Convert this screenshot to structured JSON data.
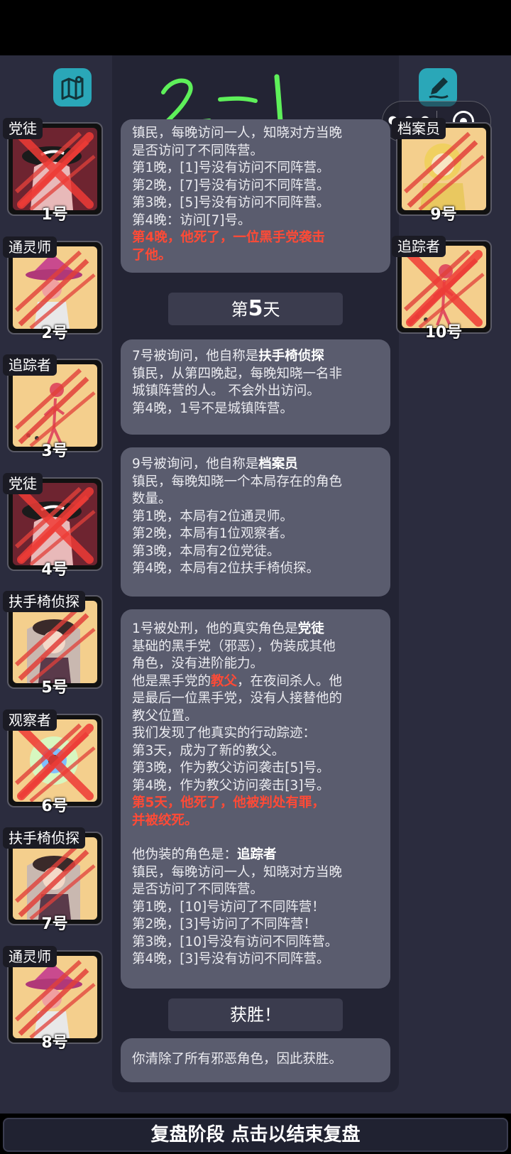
{
  "toolbar": {
    "map_icon": "map-icon",
    "edit_icon": "pen-icon",
    "capsule_more": "•••",
    "capsule_close_icon": "target-close-icon"
  },
  "left_players": [
    {
      "role": "党徒",
      "num": "1号",
      "art": "gangster",
      "crossed": true
    },
    {
      "role": "通灵师",
      "num": "2号",
      "art": "medium",
      "crossed": false
    },
    {
      "role": "追踪者",
      "num": "3号",
      "art": "tracker",
      "crossed": false
    },
    {
      "role": "党徒",
      "num": "4号",
      "art": "gangster",
      "crossed": true
    },
    {
      "role": "扶手椅侦探",
      "num": "5号",
      "art": "detective",
      "crossed": false
    },
    {
      "role": "观察者",
      "num": "6号",
      "art": "observer",
      "crossed": true
    },
    {
      "role": "扶手椅侦探",
      "num": "7号",
      "art": "detective",
      "crossed": false
    },
    {
      "role": "通灵师",
      "num": "8号",
      "art": "medium",
      "crossed": false
    }
  ],
  "right_players": [
    {
      "role": "档案员",
      "num": "9号",
      "art": "archivist",
      "crossed": false
    },
    {
      "role": "追踪者",
      "num": "10号",
      "art": "tracker",
      "crossed": true
    }
  ],
  "card1": {
    "lines": [
      "镇民，每晚访问一人，知晓对方当晚",
      "是否访问了不同阵营。",
      "第1晚，[1]号没有访问不同阵营。",
      "第2晚，[7]号没有访问不同阵营。",
      "第3晚，[5]号没有访问不同阵营。",
      "第4晚：访问[7]号。"
    ],
    "red": [
      "第4晚，他死了，一位黑手党袭击",
      "了他。"
    ]
  },
  "day5": {
    "prefix": "第",
    "num": "5",
    "suffix": "天"
  },
  "card2": {
    "intro": "7号被询问，他自称是",
    "role": "扶手椅侦探",
    "lines": [
      "镇民，从第四晚起，每晚知晓一名非",
      "城镇阵营的人。 不会外出访问。",
      "第4晚，1号不是城镇阵营。"
    ]
  },
  "card3": {
    "intro": "9号被询问，他自称是",
    "role": "档案员",
    "lines": [
      "镇民，每晚知晓一个本局存在的角色",
      "数量。",
      "第1晚，本局有2位通灵师。",
      "第2晚，本局有1位观察者。",
      "第3晚，本局有2位党徒。",
      "第4晚，本局有2位扶手椅侦探。"
    ]
  },
  "card4": {
    "intro": "1号被处刑，他的真实角色是",
    "role": "党徒",
    "line_a": "基础的黑手党（邪恶），伪装成其他",
    "line_b": "角色，没有进阶能力。",
    "line_c_pre": "他是黑手党的",
    "line_c_red": "教父",
    "line_c_post": "，在夜间杀人。他",
    "line_d": "是最后一位黑手党，没有人接替他的",
    "line_e": "教父位置。",
    "line_f": "我们发现了他真实的行动踪迹：",
    "trace": [
      "第3天，成为了新的教父。",
      "第3晚，作为教父访问袭击[5]号。",
      "第4晚，作为教父访问袭击[3]号。"
    ],
    "red": [
      "第5天，他死了，他被判处有罪，",
      "并被绞死。"
    ],
    "disguise_intro": "他伪装的角色是：",
    "disguise_role": "追踪者",
    "disguise_lines": [
      "镇民，每晚访问一人，知晓对方当晚",
      "是否访问了不同阵营。",
      "第1晚，[10]号访问了不同阵营！",
      "第2晚，[3]号访问了不同阵营！",
      "第3晚，[10]号没有访问不同阵营。",
      "第4晚，[3]号没有访问不同阵营。"
    ]
  },
  "victory_chip": "获胜！",
  "card5": {
    "text": "你清除了所有邪恶角色，因此获胜。"
  },
  "footer": {
    "label": "复盘阶段 点击以结束复盘"
  },
  "colors": {
    "accent_teal": "#2aa7b8",
    "red_text": "#ff4a36",
    "scrawl_green": "#5ef05a"
  }
}
